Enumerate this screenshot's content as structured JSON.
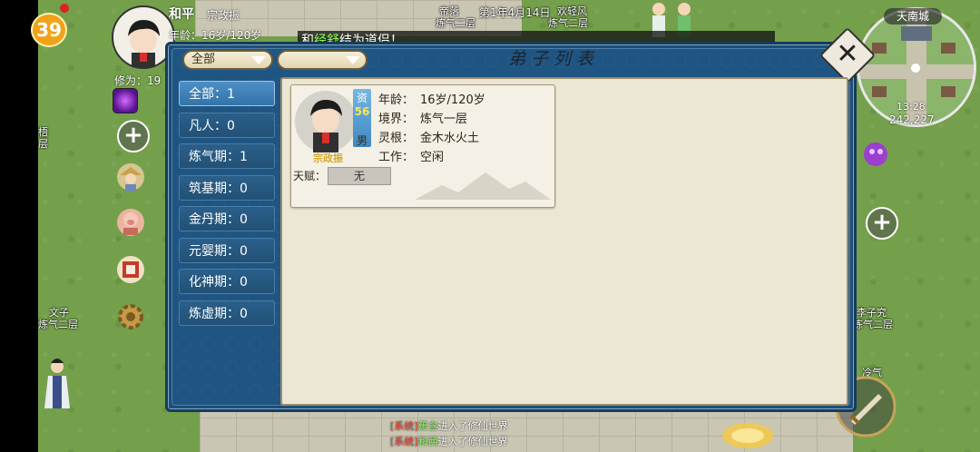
{
  "player": {
    "name": "和平",
    "sect_name": "宗政振",
    "age_text": "年龄：16岁/120岁",
    "level": "39",
    "cultivation_text": "修为：19"
  },
  "top_labels": {
    "lbl1": "帝落",
    "lbl1_sub": "炼气二层",
    "date": "第1年4月14日",
    "lbl2": "欢轻风",
    "lbl2_sub": "炼气二层"
  },
  "notice": {
    "prefix": "和",
    "highlight": "经舒",
    "suffix": "结为道侣！"
  },
  "map_labels": {
    "left_top": "梧",
    "left_top_sub": "层",
    "left_mid": "文子",
    "left_mid_sub": "炼气二层",
    "right_mid": "李子究",
    "right_mid_sub": "炼气二层",
    "right_low": "冷气"
  },
  "dialog": {
    "title": "弟子列表",
    "filter1": "全部",
    "filter2": "",
    "categories": [
      {
        "label": "全部：1",
        "active": true
      },
      {
        "label": "凡人：0",
        "active": false
      },
      {
        "label": "炼气期：1",
        "active": false
      },
      {
        "label": "筑基期：0",
        "active": false
      },
      {
        "label": "金丹期：0",
        "active": false
      },
      {
        "label": "元婴期：0",
        "active": false
      },
      {
        "label": "化神期：0",
        "active": false
      },
      {
        "label": "炼虚期：0",
        "active": false
      }
    ],
    "disciple": {
      "name": "宗政振",
      "aptitude_label": "资",
      "aptitude_value": "56",
      "gender": "男",
      "age_label": "年龄：",
      "age_value": "16岁/120岁",
      "realm_label": "境界：",
      "realm_value": "炼气一层",
      "root_label": "灵根：",
      "root_value": "金木水火土",
      "job_label": "工作：",
      "job_value": "空闲",
      "talent_label": "天赋：",
      "talent_value": "无"
    }
  },
  "minimap": {
    "title": "天南城",
    "time": "13:28",
    "coords": "242,227"
  },
  "chat": [
    {
      "tag": "[系统]",
      "who": "蕉含",
      "text": "进入了修仙世界"
    },
    {
      "tag": "[系统]",
      "who": "和西",
      "text": "进入了修仙世界"
    }
  ],
  "colors": {
    "dialog_bg": "#1f5582",
    "active_tab": "#3274a8",
    "highlight_green": "#8aff5a",
    "system_red": "#ff4b3b"
  }
}
